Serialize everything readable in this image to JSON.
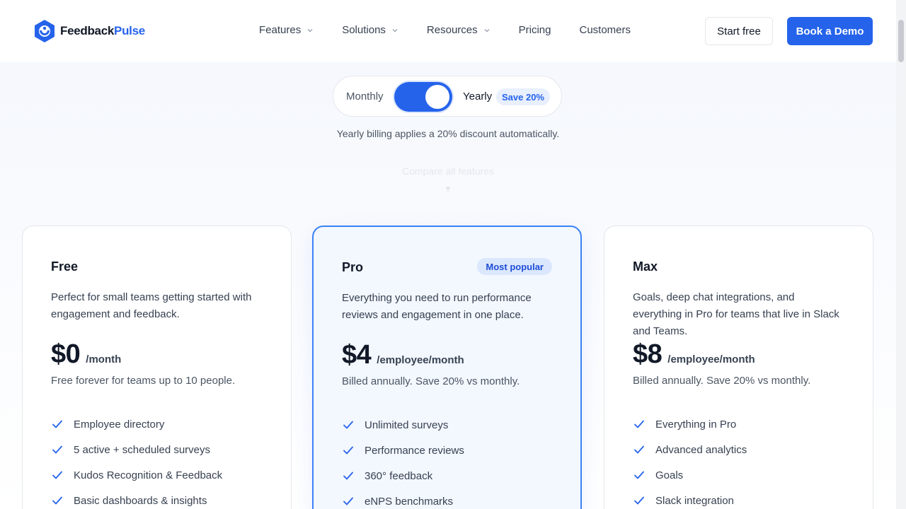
{
  "brand": {
    "name_part1": "Feedback",
    "name_part2": "Pulse",
    "primary_color": "#2563eb"
  },
  "nav": {
    "items": [
      {
        "label": "Features",
        "has_dropdown": true
      },
      {
        "label": "Solutions",
        "has_dropdown": true
      },
      {
        "label": "Resources",
        "has_dropdown": true
      },
      {
        "label": "Pricing",
        "has_dropdown": false
      },
      {
        "label": "Customers",
        "has_dropdown": false
      }
    ],
    "start_label": "Start free",
    "demo_label": "Book a Demo"
  },
  "billing": {
    "monthly_label": "Monthly",
    "yearly_label": "Yearly",
    "selected": "Yearly",
    "save_badge": "Save 20%",
    "note": "Yearly billing applies a 20% discount automatically.",
    "compare_label": "Compare all features"
  },
  "plans": [
    {
      "name": "Free",
      "badge": "",
      "description": "Perfect for small teams getting started with engagement and feedback.",
      "price": "$0",
      "unit": "/month",
      "note": "Free forever for teams up to 10 people.",
      "features": [
        "Employee directory",
        "5 active + scheduled surveys",
        "Kudos Recognition & Feedback",
        "Basic dashboards & insights"
      ]
    },
    {
      "name": "Pro",
      "badge": "Most popular",
      "description": "Everything you need to run performance reviews and engagement in one place.",
      "price": "$4",
      "unit": "/employee/month",
      "note": "Billed annually. Save 20% vs monthly.",
      "features": [
        "Unlimited surveys",
        "Performance reviews",
        "360° feedback",
        "eNPS benchmarks"
      ]
    },
    {
      "name": "Max",
      "badge": "",
      "description": "Goals, deep chat integrations, and everything in Pro for teams that live in Slack and Teams.",
      "price": "$8",
      "unit": "/employee/month",
      "note": "Billed annually. Save 20% vs monthly.",
      "features": [
        "Everything in Pro",
        "Advanced analytics",
        "Goals",
        "Slack integration"
      ]
    }
  ]
}
